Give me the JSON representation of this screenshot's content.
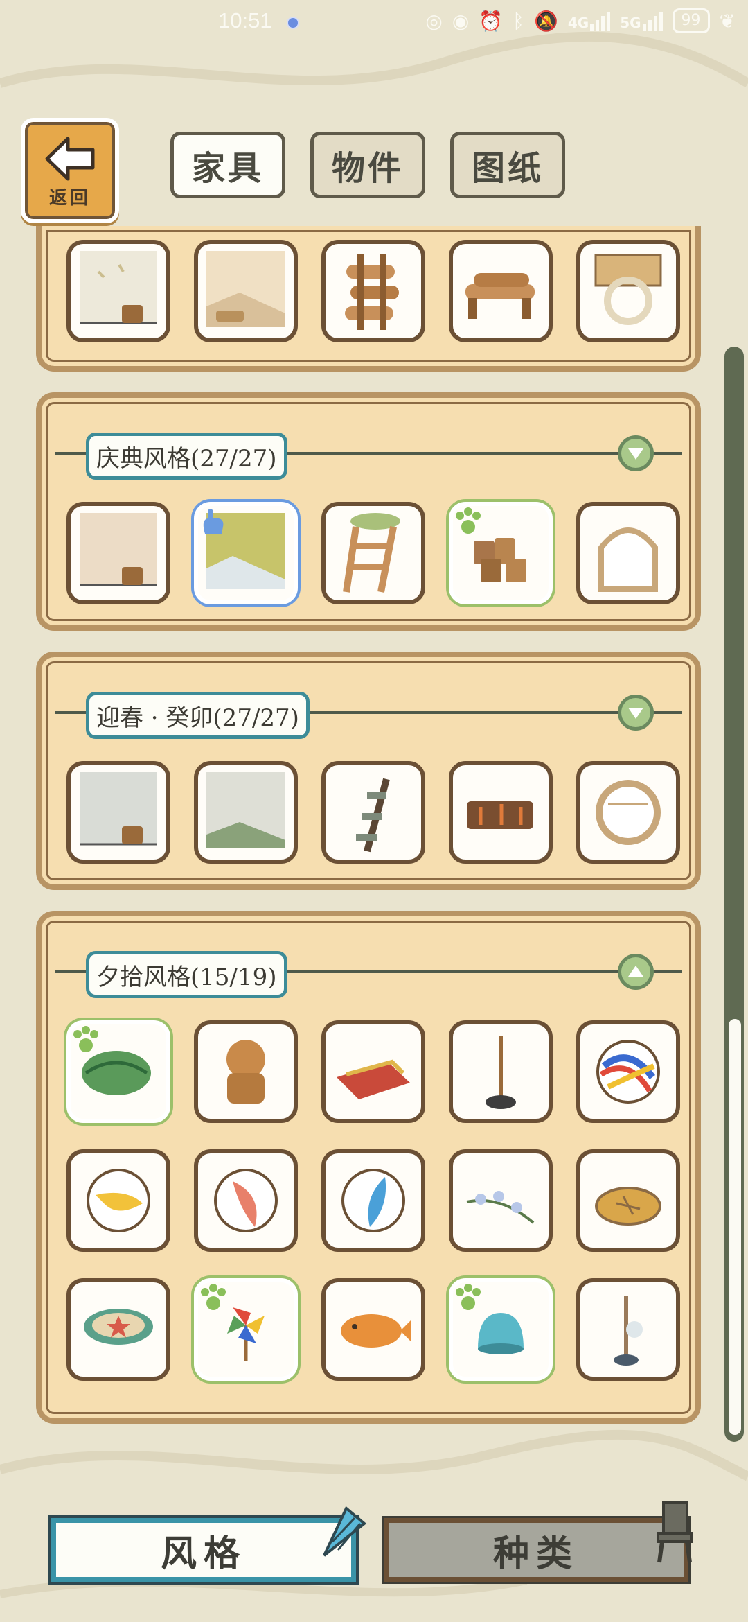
{
  "status_bar": {
    "time": "10:51",
    "network1": "4G",
    "network2": "5G",
    "battery": "99"
  },
  "header": {
    "back_label": "返回",
    "tabs": [
      {
        "label": "家具",
        "active": true
      },
      {
        "label": "物件",
        "active": false
      },
      {
        "label": "图纸",
        "active": false
      }
    ]
  },
  "sections": [
    {
      "title": "庆典风格(27/27)"
    },
    {
      "title": "迎春 · 癸卯(27/27)"
    },
    {
      "title": "夕拾风格(15/19)"
    }
  ],
  "bottom": {
    "style_label": "风格",
    "kind_label": "种类"
  },
  "colors": {
    "background": "#e9e4cf",
    "panel": "#f6deb0",
    "panel_border": "#b89464",
    "item_border": "#6b5035",
    "accent_teal": "#3d8c98",
    "owned_green": "#9cc06a",
    "selected_blue": "#6a9be0"
  }
}
